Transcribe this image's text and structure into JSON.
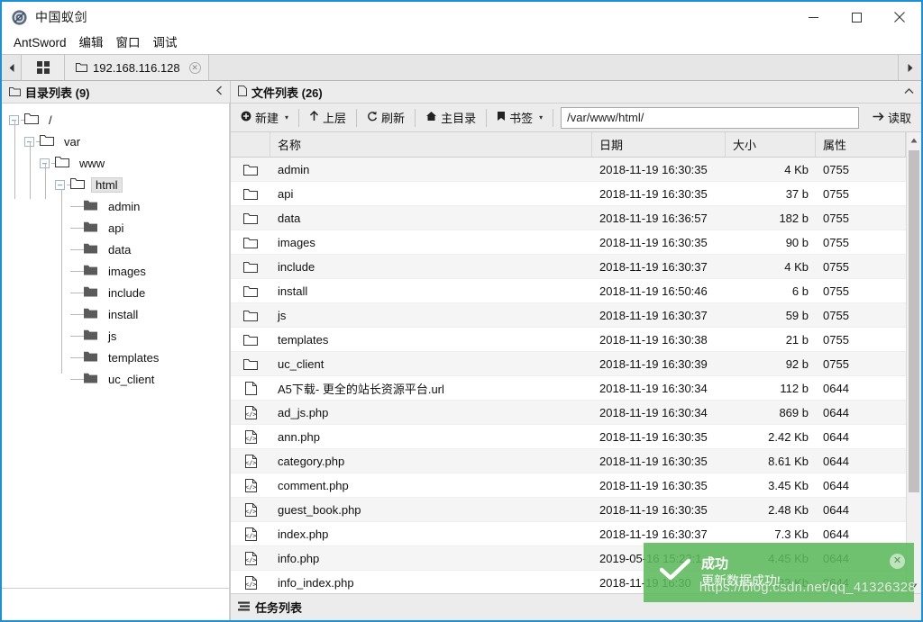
{
  "window": {
    "title": "中国蚁剑",
    "logo_icon": "antsword-logo-icon",
    "minimize": "—",
    "maximize": "☐",
    "close": "✕"
  },
  "menubar": {
    "items": [
      {
        "label": "AntSword",
        "name": "menu-antsword"
      },
      {
        "label": "编辑",
        "name": "menu-edit"
      },
      {
        "label": "窗口",
        "name": "menu-window"
      },
      {
        "label": "调试",
        "name": "menu-debug"
      }
    ]
  },
  "tabbar": {
    "prev_arrow": "◀",
    "next_arrow": "▶",
    "grid_icon": "grid-icon",
    "tabs": [
      {
        "label": "192.168.116.128",
        "icon": "folder-icon",
        "close": "✕",
        "active": true
      }
    ]
  },
  "left_panel": {
    "title": "目录列表 (9)",
    "icon": "folder-outline-icon",
    "collapse_icon": "‹",
    "tree": [
      {
        "label": "/",
        "depth": 0,
        "twist": "–",
        "icon": "folder-outline-icon",
        "selected": false
      },
      {
        "label": "var",
        "depth": 1,
        "twist": "–",
        "icon": "folder-outline-icon",
        "selected": false
      },
      {
        "label": "www",
        "depth": 2,
        "twist": "–",
        "icon": "folder-outline-icon",
        "selected": false
      },
      {
        "label": "html",
        "depth": 3,
        "twist": "–",
        "icon": "folder-outline-icon",
        "selected": true
      },
      {
        "label": "admin",
        "depth": 4,
        "twist": "",
        "icon": "folder-solid-icon",
        "selected": false
      },
      {
        "label": "api",
        "depth": 4,
        "twist": "",
        "icon": "folder-solid-icon",
        "selected": false
      },
      {
        "label": "data",
        "depth": 4,
        "twist": "",
        "icon": "folder-solid-icon",
        "selected": false
      },
      {
        "label": "images",
        "depth": 4,
        "twist": "",
        "icon": "folder-solid-icon",
        "selected": false
      },
      {
        "label": "include",
        "depth": 4,
        "twist": "",
        "icon": "folder-solid-icon",
        "selected": false
      },
      {
        "label": "install",
        "depth": 4,
        "twist": "",
        "icon": "folder-solid-icon",
        "selected": false
      },
      {
        "label": "js",
        "depth": 4,
        "twist": "",
        "icon": "folder-solid-icon",
        "selected": false
      },
      {
        "label": "templates",
        "depth": 4,
        "twist": "",
        "icon": "folder-solid-icon",
        "selected": false
      },
      {
        "label": "uc_client",
        "depth": 4,
        "twist": "",
        "icon": "folder-solid-icon",
        "selected": false
      }
    ]
  },
  "right_panel": {
    "title": "文件列表 (26)",
    "icon": "file-outline-icon",
    "collapse_icon": "⌃",
    "toolbar": {
      "new_label": "新建",
      "new_icon": "plus-circle-icon",
      "new_caret": "▾",
      "up_label": "上层",
      "up_icon": "arrow-up-icon",
      "refresh_label": "刷新",
      "refresh_icon": "refresh-icon",
      "home_label": "主目录",
      "home_icon": "home-icon",
      "bookmark_label": "书签",
      "bookmark_icon": "bookmark-icon",
      "bookmark_caret": "▾",
      "path_value": "/var/www/html/",
      "path_placeholder": "/var/www/html/",
      "read_label": "读取",
      "read_icon": "arrow-right-icon"
    },
    "columns": [
      "",
      "名称",
      "日期",
      "大小",
      "属性"
    ],
    "rows": [
      {
        "icon": "folder-outline-icon",
        "name": "admin",
        "date": "2018-11-19 16:30:35",
        "size": "4 Kb",
        "attr": "0755"
      },
      {
        "icon": "folder-outline-icon",
        "name": "api",
        "date": "2018-11-19 16:30:35",
        "size": "37 b",
        "attr": "0755"
      },
      {
        "icon": "folder-outline-icon",
        "name": "data",
        "date": "2018-11-19 16:36:57",
        "size": "182 b",
        "attr": "0755"
      },
      {
        "icon": "folder-outline-icon",
        "name": "images",
        "date": "2018-11-19 16:30:35",
        "size": "90 b",
        "attr": "0755"
      },
      {
        "icon": "folder-outline-icon",
        "name": "include",
        "date": "2018-11-19 16:30:37",
        "size": "4 Kb",
        "attr": "0755"
      },
      {
        "icon": "folder-outline-icon",
        "name": "install",
        "date": "2018-11-19 16:50:46",
        "size": "6 b",
        "attr": "0755"
      },
      {
        "icon": "folder-outline-icon",
        "name": "js",
        "date": "2018-11-19 16:30:37",
        "size": "59 b",
        "attr": "0755"
      },
      {
        "icon": "folder-outline-icon",
        "name": "templates",
        "date": "2018-11-19 16:30:38",
        "size": "21 b",
        "attr": "0755"
      },
      {
        "icon": "folder-outline-icon",
        "name": "uc_client",
        "date": "2018-11-19 16:30:39",
        "size": "92 b",
        "attr": "0755"
      },
      {
        "icon": "file-outline-icon",
        "name": "A5下载- 更全的站长资源平台.url",
        "date": "2018-11-19 16:30:34",
        "size": "112 b",
        "attr": "0644"
      },
      {
        "icon": "file-code-icon",
        "name": "ad_js.php",
        "date": "2018-11-19 16:30:34",
        "size": "869 b",
        "attr": "0644"
      },
      {
        "icon": "file-code-icon",
        "name": "ann.php",
        "date": "2018-11-19 16:30:35",
        "size": "2.42 Kb",
        "attr": "0644"
      },
      {
        "icon": "file-code-icon",
        "name": "category.php",
        "date": "2018-11-19 16:30:35",
        "size": "8.61 Kb",
        "attr": "0644"
      },
      {
        "icon": "file-code-icon",
        "name": "comment.php",
        "date": "2018-11-19 16:30:35",
        "size": "3.45 Kb",
        "attr": "0644"
      },
      {
        "icon": "file-code-icon",
        "name": "guest_book.php",
        "date": "2018-11-19 16:30:35",
        "size": "2.48 Kb",
        "attr": "0644"
      },
      {
        "icon": "file-code-icon",
        "name": "index.php",
        "date": "2018-11-19 16:30:37",
        "size": "7.3 Kb",
        "attr": "0644"
      },
      {
        "icon": "file-code-icon",
        "name": "info.php",
        "date": "2019-05-16 15:22:1",
        "size": "4.45 Kb",
        "attr": "0644"
      },
      {
        "icon": "file-code-icon",
        "name": "info_index.php",
        "date": "2018-11-19 16:30",
        "size": ".83 Kb",
        "attr": "0644"
      }
    ],
    "scrollbar": {
      "up_arrow": "▲",
      "down_arrow": "▼"
    }
  },
  "taskbar": {
    "label": "任务列表",
    "icon": "list-icon"
  },
  "toast": {
    "title": "成功",
    "message": "更新数据成功!",
    "check_icon": "check-icon",
    "close_icon": "close-icon",
    "color": "#5cb85c"
  },
  "watermark": "https://blog.csdn.net/qq_41326328"
}
